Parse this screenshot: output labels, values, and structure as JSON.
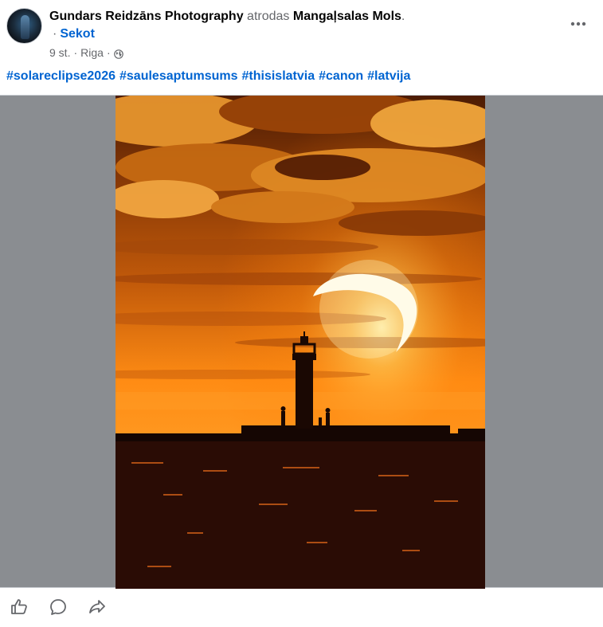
{
  "post": {
    "author": "Gundars Reidzāns Photography",
    "at_word": "atrodas",
    "location": "Mangaļsalas Mols",
    "location_suffix": ".",
    "follow_separator": "·",
    "follow_label": "Sekot",
    "time": "9 st.",
    "time_separator": "·",
    "city": "Riga",
    "city_separator": "·",
    "privacy_icon": "globe-icon",
    "more_icon": "more-options-icon",
    "hashtags": [
      "#solareclipse2026",
      "#saulesaptumsums",
      "#thisislatvia",
      "#canon",
      "#latvija"
    ],
    "photo_subject": "eclipse-sunset-lighthouse"
  },
  "actions": {
    "like_icon": "like-icon",
    "comment_icon": "comment-icon",
    "share_icon": "share-icon"
  },
  "colors": {
    "link": "#0064d1",
    "muted": "#65676b",
    "media_background": "#8a8d91",
    "sky_top": "#5a2205",
    "sky_glow": "#ff9a1a",
    "ground": "#2a0c05"
  }
}
